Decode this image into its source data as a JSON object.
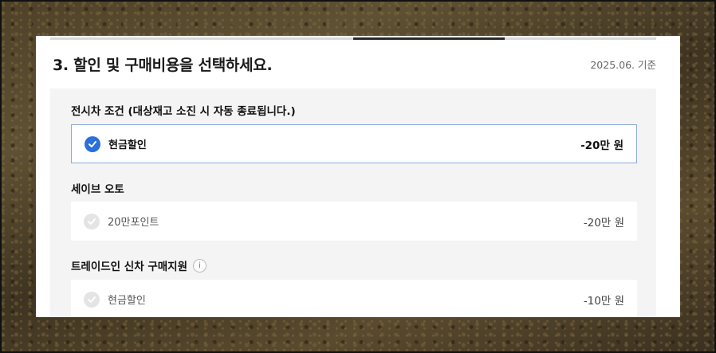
{
  "section": {
    "title": "3. 할인 및 구매비용을 선택하세요.",
    "date": "2025.06. 기준",
    "progress_fraction_start": 0.5,
    "progress_fraction_end": 0.75
  },
  "groups": [
    {
      "title": "전시차 조건 (대상재고 소진 시 자동 종료됩니다.)",
      "option": {
        "label": "현금할인",
        "value": "-20만 원",
        "selected": true
      }
    },
    {
      "title": "세이브 오토",
      "option": {
        "label": "20만포인트",
        "value": "-20만 원",
        "selected": false
      }
    },
    {
      "title": "트레이드인 신차 구매지원",
      "info_icon": "i",
      "option": {
        "label": "현금할인",
        "value": "-10만 원",
        "selected": false
      }
    }
  ],
  "colors": {
    "accent": "#2a6fdb",
    "selected_border": "#8aa9d8"
  },
  "icons": {
    "check": "check-icon",
    "info": "info-icon"
  }
}
